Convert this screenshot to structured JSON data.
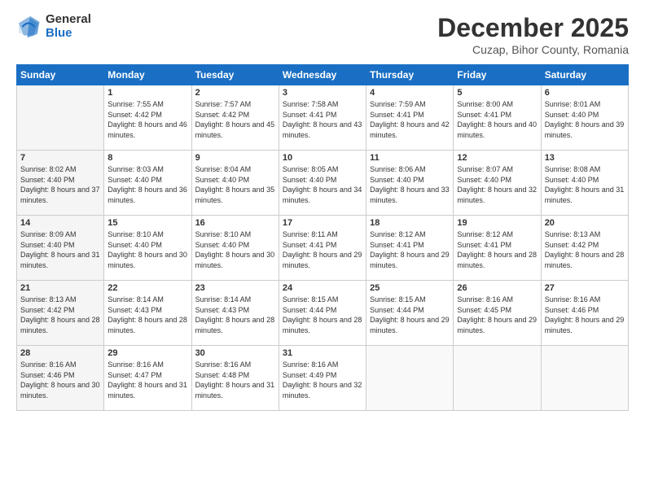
{
  "logo": {
    "general": "General",
    "blue": "Blue"
  },
  "title": "December 2025",
  "subtitle": "Cuzap, Bihor County, Romania",
  "days_header": [
    "Sunday",
    "Monday",
    "Tuesday",
    "Wednesday",
    "Thursday",
    "Friday",
    "Saturday"
  ],
  "weeks": [
    [
      {
        "day": "",
        "sunrise": "",
        "sunset": "",
        "daylight": ""
      },
      {
        "day": "1",
        "sunrise": "Sunrise: 7:55 AM",
        "sunset": "Sunset: 4:42 PM",
        "daylight": "Daylight: 8 hours and 46 minutes."
      },
      {
        "day": "2",
        "sunrise": "Sunrise: 7:57 AM",
        "sunset": "Sunset: 4:42 PM",
        "daylight": "Daylight: 8 hours and 45 minutes."
      },
      {
        "day": "3",
        "sunrise": "Sunrise: 7:58 AM",
        "sunset": "Sunset: 4:41 PM",
        "daylight": "Daylight: 8 hours and 43 minutes."
      },
      {
        "day": "4",
        "sunrise": "Sunrise: 7:59 AM",
        "sunset": "Sunset: 4:41 PM",
        "daylight": "Daylight: 8 hours and 42 minutes."
      },
      {
        "day": "5",
        "sunrise": "Sunrise: 8:00 AM",
        "sunset": "Sunset: 4:41 PM",
        "daylight": "Daylight: 8 hours and 40 minutes."
      },
      {
        "day": "6",
        "sunrise": "Sunrise: 8:01 AM",
        "sunset": "Sunset: 4:40 PM",
        "daylight": "Daylight: 8 hours and 39 minutes."
      }
    ],
    [
      {
        "day": "7",
        "sunrise": "Sunrise: 8:02 AM",
        "sunset": "Sunset: 4:40 PM",
        "daylight": "Daylight: 8 hours and 37 minutes."
      },
      {
        "day": "8",
        "sunrise": "Sunrise: 8:03 AM",
        "sunset": "Sunset: 4:40 PM",
        "daylight": "Daylight: 8 hours and 36 minutes."
      },
      {
        "day": "9",
        "sunrise": "Sunrise: 8:04 AM",
        "sunset": "Sunset: 4:40 PM",
        "daylight": "Daylight: 8 hours and 35 minutes."
      },
      {
        "day": "10",
        "sunrise": "Sunrise: 8:05 AM",
        "sunset": "Sunset: 4:40 PM",
        "daylight": "Daylight: 8 hours and 34 minutes."
      },
      {
        "day": "11",
        "sunrise": "Sunrise: 8:06 AM",
        "sunset": "Sunset: 4:40 PM",
        "daylight": "Daylight: 8 hours and 33 minutes."
      },
      {
        "day": "12",
        "sunrise": "Sunrise: 8:07 AM",
        "sunset": "Sunset: 4:40 PM",
        "daylight": "Daylight: 8 hours and 32 minutes."
      },
      {
        "day": "13",
        "sunrise": "Sunrise: 8:08 AM",
        "sunset": "Sunset: 4:40 PM",
        "daylight": "Daylight: 8 hours and 31 minutes."
      }
    ],
    [
      {
        "day": "14",
        "sunrise": "Sunrise: 8:09 AM",
        "sunset": "Sunset: 4:40 PM",
        "daylight": "Daylight: 8 hours and 31 minutes."
      },
      {
        "day": "15",
        "sunrise": "Sunrise: 8:10 AM",
        "sunset": "Sunset: 4:40 PM",
        "daylight": "Daylight: 8 hours and 30 minutes."
      },
      {
        "day": "16",
        "sunrise": "Sunrise: 8:10 AM",
        "sunset": "Sunset: 4:40 PM",
        "daylight": "Daylight: 8 hours and 30 minutes."
      },
      {
        "day": "17",
        "sunrise": "Sunrise: 8:11 AM",
        "sunset": "Sunset: 4:41 PM",
        "daylight": "Daylight: 8 hours and 29 minutes."
      },
      {
        "day": "18",
        "sunrise": "Sunrise: 8:12 AM",
        "sunset": "Sunset: 4:41 PM",
        "daylight": "Daylight: 8 hours and 29 minutes."
      },
      {
        "day": "19",
        "sunrise": "Sunrise: 8:12 AM",
        "sunset": "Sunset: 4:41 PM",
        "daylight": "Daylight: 8 hours and 28 minutes."
      },
      {
        "day": "20",
        "sunrise": "Sunrise: 8:13 AM",
        "sunset": "Sunset: 4:42 PM",
        "daylight": "Daylight: 8 hours and 28 minutes."
      }
    ],
    [
      {
        "day": "21",
        "sunrise": "Sunrise: 8:13 AM",
        "sunset": "Sunset: 4:42 PM",
        "daylight": "Daylight: 8 hours and 28 minutes."
      },
      {
        "day": "22",
        "sunrise": "Sunrise: 8:14 AM",
        "sunset": "Sunset: 4:43 PM",
        "daylight": "Daylight: 8 hours and 28 minutes."
      },
      {
        "day": "23",
        "sunrise": "Sunrise: 8:14 AM",
        "sunset": "Sunset: 4:43 PM",
        "daylight": "Daylight: 8 hours and 28 minutes."
      },
      {
        "day": "24",
        "sunrise": "Sunrise: 8:15 AM",
        "sunset": "Sunset: 4:44 PM",
        "daylight": "Daylight: 8 hours and 28 minutes."
      },
      {
        "day": "25",
        "sunrise": "Sunrise: 8:15 AM",
        "sunset": "Sunset: 4:44 PM",
        "daylight": "Daylight: 8 hours and 29 minutes."
      },
      {
        "day": "26",
        "sunrise": "Sunrise: 8:16 AM",
        "sunset": "Sunset: 4:45 PM",
        "daylight": "Daylight: 8 hours and 29 minutes."
      },
      {
        "day": "27",
        "sunrise": "Sunrise: 8:16 AM",
        "sunset": "Sunset: 4:46 PM",
        "daylight": "Daylight: 8 hours and 29 minutes."
      }
    ],
    [
      {
        "day": "28",
        "sunrise": "Sunrise: 8:16 AM",
        "sunset": "Sunset: 4:46 PM",
        "daylight": "Daylight: 8 hours and 30 minutes."
      },
      {
        "day": "29",
        "sunrise": "Sunrise: 8:16 AM",
        "sunset": "Sunset: 4:47 PM",
        "daylight": "Daylight: 8 hours and 31 minutes."
      },
      {
        "day": "30",
        "sunrise": "Sunrise: 8:16 AM",
        "sunset": "Sunset: 4:48 PM",
        "daylight": "Daylight: 8 hours and 31 minutes."
      },
      {
        "day": "31",
        "sunrise": "Sunrise: 8:16 AM",
        "sunset": "Sunset: 4:49 PM",
        "daylight": "Daylight: 8 hours and 32 minutes."
      },
      {
        "day": "",
        "sunrise": "",
        "sunset": "",
        "daylight": ""
      },
      {
        "day": "",
        "sunrise": "",
        "sunset": "",
        "daylight": ""
      },
      {
        "day": "",
        "sunrise": "",
        "sunset": "",
        "daylight": ""
      }
    ]
  ]
}
